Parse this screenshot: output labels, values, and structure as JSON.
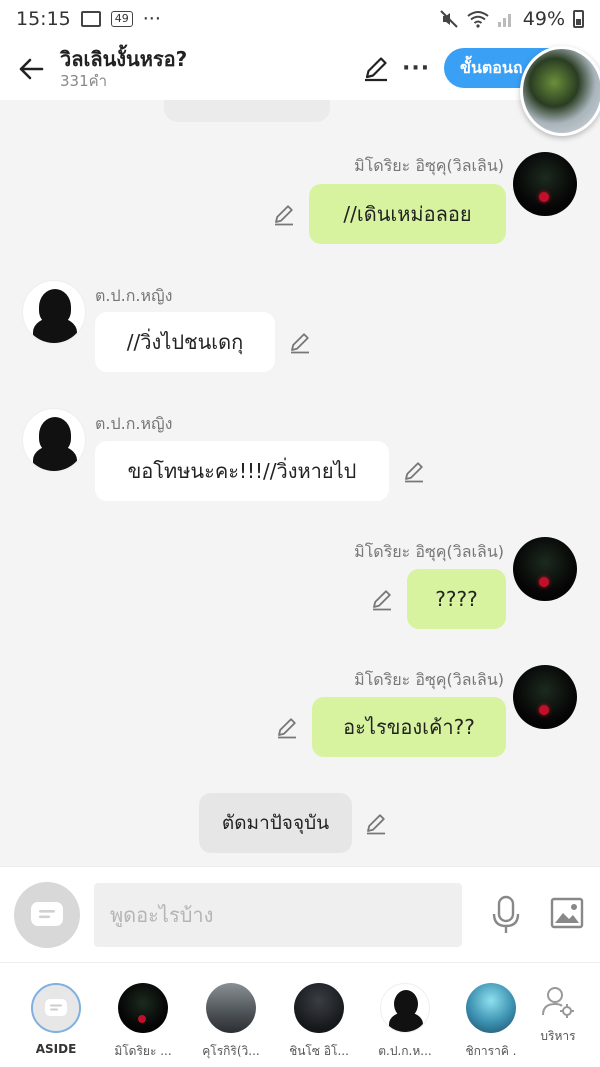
{
  "status_bar": {
    "time": "15:15",
    "badge": "49",
    "dots": "···",
    "battery_text": "49%"
  },
  "header": {
    "title": "วิลเลินงั้นหรอ?",
    "subtitle": "331คำ",
    "next_button": "ขั้นตอนถ",
    "more": "···"
  },
  "messages": [
    {
      "side": "right",
      "name": "มิโดริยะ อิซุคุ(วิลเลิน)",
      "text": "//เดินเหม่อลอย",
      "style": "green"
    },
    {
      "side": "left",
      "name": "ต.ป.ก.หญิง",
      "text": "//วิ่งไปชนเดกุ",
      "style": "white"
    },
    {
      "side": "left",
      "name": "ต.ป.ก.หญิง",
      "text": "ขอโทษนะคะ!!!//วิ่งหายไป",
      "style": "white"
    },
    {
      "side": "right",
      "name": "มิโดริยะ อิซุคุ(วิลเลิน)",
      "text": "????",
      "style": "green"
    },
    {
      "side": "right",
      "name": "มิโดริยะ อิซุคุ(วิลเลิน)",
      "text": "อะไรของเค้า??",
      "style": "green"
    },
    {
      "side": "center",
      "text": "ตัดมาปัจจุบัน",
      "style": "gray"
    }
  ],
  "input": {
    "placeholder": "พูดอะไรบ้าง"
  },
  "characters": [
    {
      "name": "ASIDE"
    },
    {
      "name": "มิโดริยะ ..."
    },
    {
      "name": "คุโรกิริ(วิ..."
    },
    {
      "name": "ชินโซ อิโ..."
    },
    {
      "name": "ต.ป.ก.ห..."
    },
    {
      "name": "ชิการาคิ ."
    }
  ],
  "manage_label": "บริหาร",
  "colors": {
    "accent": "#3aa0f5",
    "my_bubble": "#d7f3a0",
    "other_bubble": "#ffffff",
    "narration_bubble": "#e6e6e6"
  }
}
